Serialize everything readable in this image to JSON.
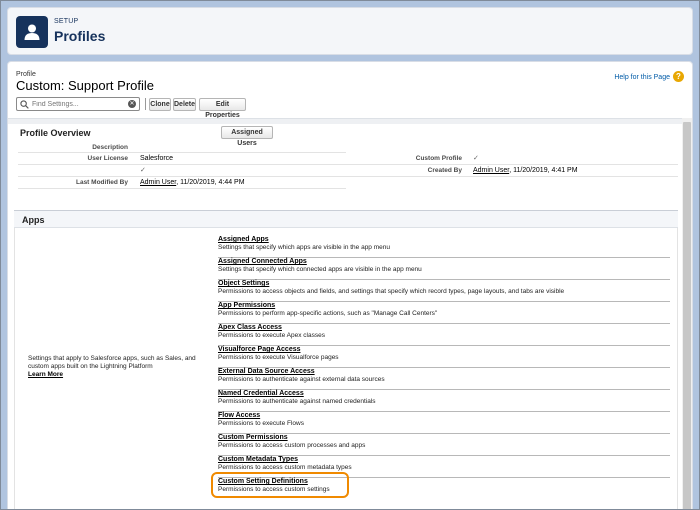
{
  "header": {
    "eyebrow": "SETUP",
    "title": "Profiles"
  },
  "page": {
    "crumb": "Profile",
    "title": "Custom: Support Profile",
    "help_link": "Help for this Page"
  },
  "toolbar": {
    "search_placeholder": "Find Settings...",
    "clone": "Clone",
    "delete": "Delete",
    "edit_properties": "Edit Properties"
  },
  "overview": {
    "title": "Profile Overview",
    "assigned_users_button": "Assigned Users",
    "description_label": "Description",
    "user_license_label": "User License",
    "user_license_value": "Salesforce",
    "custom_profile_label": "Custom Profile",
    "created_by_label": "Created By",
    "created_by_user": "Admin User",
    "created_by_date": ", 11/20/2019, 4:41 PM",
    "last_modified_label": "Last Modified By",
    "last_modified_user": "Admin User",
    "last_modified_date": ", 11/20/2019, 4:44 PM"
  },
  "apps": {
    "title": "Apps",
    "description": "Settings that apply to Salesforce apps, such as Sales, and custom apps built on the Lightning Platform",
    "learn_more": "Learn More",
    "items": [
      {
        "title": "Assigned Apps",
        "desc": "Settings that specify which apps are visible in the app menu"
      },
      {
        "title": "Assigned Connected Apps",
        "desc": "Settings that specify which connected apps are visible in the app menu"
      },
      {
        "title": "Object Settings",
        "desc": "Permissions to access objects and fields, and settings that specify which record types, page layouts, and tabs are visible"
      },
      {
        "title": "App Permissions",
        "desc": "Permissions to perform app-specific actions, such as \"Manage Call Centers\""
      },
      {
        "title": "Apex Class Access",
        "desc": "Permissions to execute Apex classes"
      },
      {
        "title": "Visualforce Page Access",
        "desc": "Permissions to execute Visualforce pages"
      },
      {
        "title": "External Data Source Access",
        "desc": "Permissions to authenticate against external data sources"
      },
      {
        "title": "Named Credential Access",
        "desc": "Permissions to authenticate against named credentials"
      },
      {
        "title": "Flow Access",
        "desc": "Permissions to execute Flows"
      },
      {
        "title": "Custom Permissions",
        "desc": "Permissions to access custom processes and apps"
      },
      {
        "title": "Custom Metadata Types",
        "desc": "Permissions to access custom metadata types"
      },
      {
        "title": "Custom Setting Definitions",
        "desc": "Permissions to access custom settings"
      }
    ]
  },
  "colors": {
    "highlight": "#f08a00",
    "brand": "#16325c"
  }
}
